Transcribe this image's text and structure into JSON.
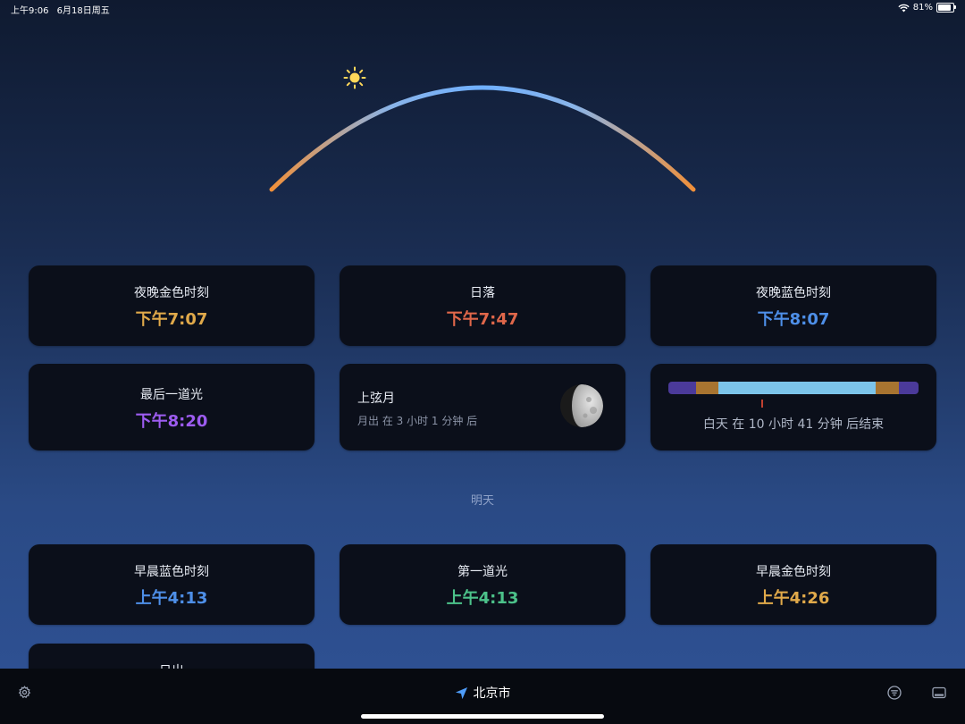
{
  "status": {
    "time": "上午9:06",
    "date": "6月18日周五",
    "battery": "81%"
  },
  "colors": {
    "golden": "#e0a94a",
    "sunset": "#e0674a",
    "blue": "#4e8fe8",
    "last_light": "#9d5cf0",
    "first_light": "#4cc28a"
  },
  "today": [
    {
      "title": "夜晚金色时刻",
      "time": "下午7:07",
      "color": "#e0a94a"
    },
    {
      "title": "日落",
      "time": "下午7:47",
      "color": "#e0674a"
    },
    {
      "title": "夜晚蓝色时刻",
      "time": "下午8:07",
      "color": "#4e8fe8"
    },
    {
      "title": "最后一道光",
      "time": "下午8:20",
      "color": "#9d5cf0"
    }
  ],
  "moon": {
    "title": "上弦月",
    "subtitle": "月出 在 3 小时 1 分钟 后"
  },
  "daylight": {
    "text": "白天 在 10 小时 41 分钟 后结束"
  },
  "tomorrow_label": "明天",
  "tomorrow": [
    {
      "title": "早晨蓝色时刻",
      "time": "上午4:13",
      "color": "#4e8fe8"
    },
    {
      "title": "第一道光",
      "time": "上午4:13",
      "color": "#4cc28a"
    },
    {
      "title": "早晨金色时刻",
      "time": "上午4:26",
      "color": "#e0a94a"
    },
    {
      "title": "日出"
    }
  ],
  "bottom": {
    "location": "北京市"
  },
  "icons": [
    "settings-icon",
    "location-arrow-icon",
    "filter-icon",
    "panel-icon",
    "sun-icon",
    "moon-icon",
    "wifi-icon",
    "battery-icon"
  ]
}
